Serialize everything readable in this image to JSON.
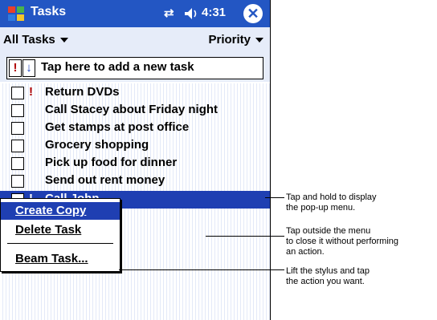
{
  "titlebar": {
    "title": "Tasks",
    "time": "4:31",
    "sync_glyph": "⇄",
    "close_glyph": "✕",
    "icons": [
      "start-flag-icon",
      "sync-icon",
      "speaker-icon",
      "close-icon"
    ]
  },
  "filters": {
    "category": "All Tasks",
    "sort": "Priority"
  },
  "entry": {
    "high_priority": "!",
    "low_priority": "↓",
    "placeholder": "Tap here to add a new task"
  },
  "tasks": [
    {
      "label": "Return DVDs",
      "priority": "!"
    },
    {
      "label": "Call Stacey about Friday night",
      "priority": ""
    },
    {
      "label": "Get stamps at post office",
      "priority": ""
    },
    {
      "label": "Grocery shopping",
      "priority": ""
    },
    {
      "label": "Pick up food for dinner",
      "priority": ""
    },
    {
      "label": "Send out rent money",
      "priority": ""
    },
    {
      "label": "Call John",
      "priority": "!"
    }
  ],
  "popup_menu": {
    "items": [
      "Create Copy",
      "Delete Task",
      "Beam Task..."
    ]
  },
  "callouts": [
    {
      "line1": "Tap and hold to display",
      "line2": "the pop-up menu.",
      "line3": ""
    },
    {
      "line1": "Tap outside the menu",
      "line2": "to close it without performing",
      "line3": "an action."
    },
    {
      "line1": "Lift the stylus and tap",
      "line2": "the action you want.",
      "line3": ""
    }
  ],
  "colors": {
    "titlebar": "#2356c3",
    "selection": "#1f3fb2",
    "toolbar_bg": "#e6ecf9",
    "priority_red": "#b00000"
  }
}
